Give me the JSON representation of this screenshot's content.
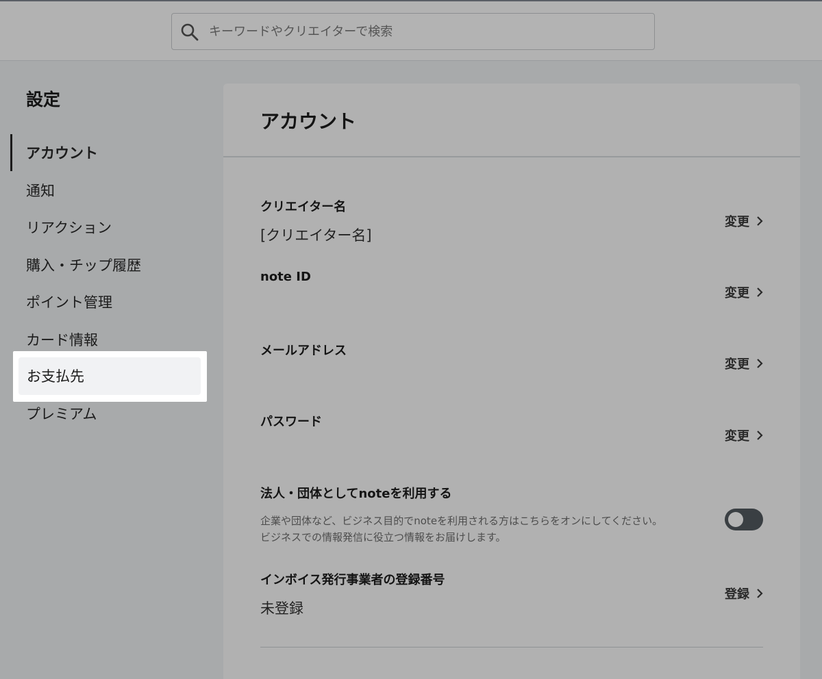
{
  "search": {
    "placeholder": "キーワードやクリエイターで検索"
  },
  "sidebar": {
    "title": "設定",
    "items": [
      {
        "label": "アカウント"
      },
      {
        "label": "通知"
      },
      {
        "label": "リアクション"
      },
      {
        "label": "購入・チップ履歴"
      },
      {
        "label": "ポイント管理"
      },
      {
        "label": "カード情報"
      },
      {
        "label": "お支払先"
      },
      {
        "label": "プレミアム"
      }
    ]
  },
  "main": {
    "title": "アカウント",
    "rows": [
      {
        "label": "クリエイター名",
        "value": "[クリエイター名]",
        "action": "変更"
      },
      {
        "label": "note ID",
        "value": "",
        "action": "変更"
      },
      {
        "label": "メールアドレス",
        "value": "",
        "action": "変更"
      },
      {
        "label": "パスワード",
        "value": "",
        "action": "変更"
      },
      {
        "label": "法人・団体としてnoteを利用する",
        "desc1": "企業や団体など、ビジネス目的でnoteを利用される方はこちらをオンにしてください。",
        "desc2": "ビジネスでの情報発信に役立つ情報をお届けします。",
        "toggle_on": false
      },
      {
        "label": "インボイス発行事業者の登録番号",
        "value": "未登録",
        "action": "登録"
      }
    ]
  },
  "colors": {
    "toggle_track": "#3a3f43",
    "highlight": "#ffffff"
  }
}
